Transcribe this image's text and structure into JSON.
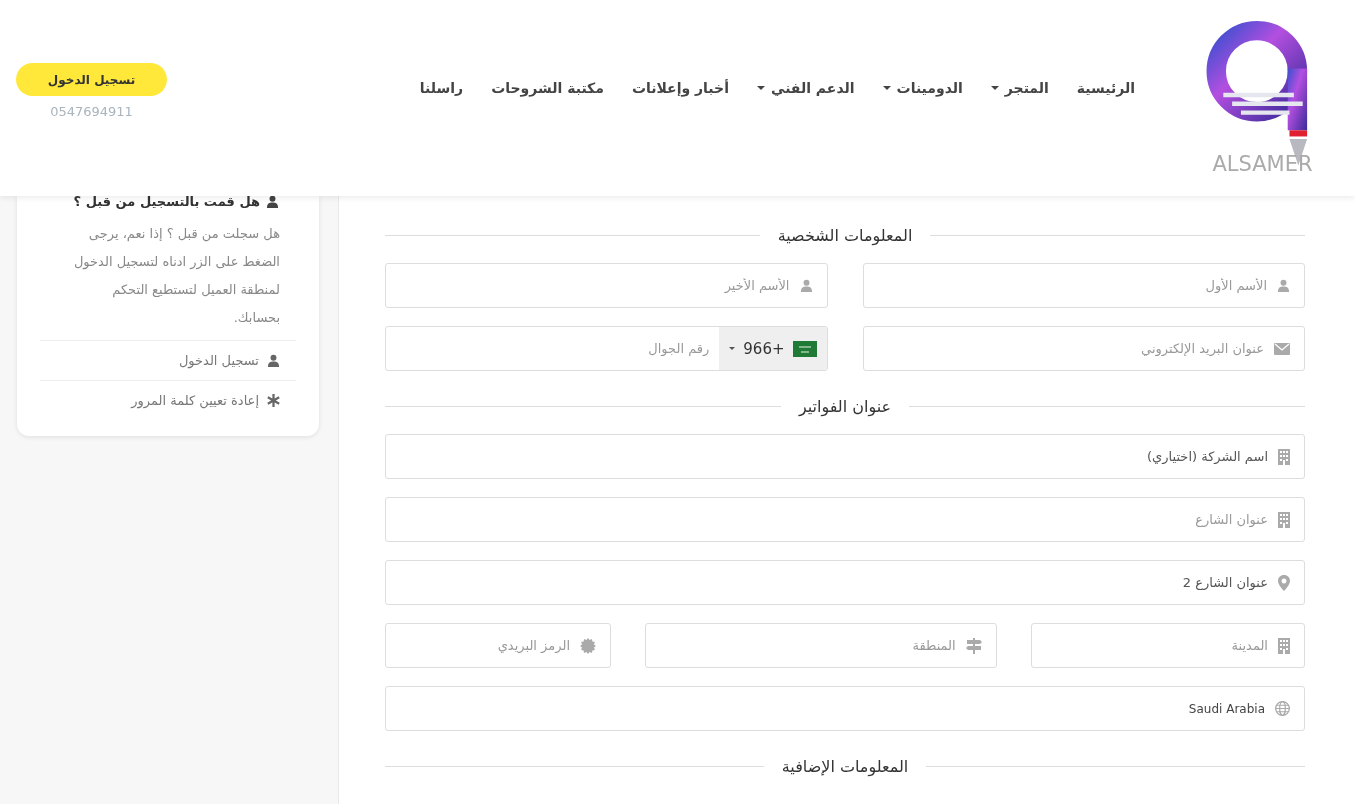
{
  "header": {
    "logo": {
      "text": "ALSAMER"
    },
    "nav": [
      {
        "label": "الرئيسية",
        "dropdown": false
      },
      {
        "label": "المتجر",
        "dropdown": true
      },
      {
        "label": "الدومينات",
        "dropdown": true
      },
      {
        "label": "الدعم الفني",
        "dropdown": true
      },
      {
        "label": "أخبار وإعلانات",
        "dropdown": false
      },
      {
        "label": "مكتبة الشروحات",
        "dropdown": false
      },
      {
        "label": "راسلنا",
        "dropdown": false
      }
    ],
    "login_button": "تسجيل الدخول",
    "phone": "0547694911"
  },
  "sidebar": {
    "title": "هل قمت بالتسجيل من قبل ؟",
    "text": "هل سجلت من قبل ؟ إذا نعم، يرجى الضغط على الزر ادناه لتسجيل الدخول لمنطقة العميل لتستطيع التحكم بحسابك.",
    "links": [
      {
        "label": "تسجيل الدخول"
      },
      {
        "label": "إعادة تعيين كلمة المرور"
      }
    ]
  },
  "form": {
    "sections": [
      {
        "title": "المعلومات الشخصية",
        "rows": [
          [
            {
              "kind": "text",
              "placeholder": "الأسم الأول"
            },
            {
              "kind": "text",
              "placeholder": "الأسم الأخير"
            }
          ],
          [
            {
              "kind": "text",
              "placeholder": "عنوان البريد الإلكتروني"
            },
            {
              "kind": "phone",
              "country_code": "966+",
              "placeholder": "رقم الجوال"
            }
          ]
        ]
      },
      {
        "title": "عنوان الفواتير",
        "rows": [
          [
            {
              "kind": "text",
              "value": "اسم الشركة (اختياري)"
            }
          ],
          [
            {
              "kind": "text",
              "placeholder": "عنوان الشارع"
            }
          ],
          [
            {
              "kind": "text",
              "value": "عنوان الشارع 2"
            }
          ],
          [
            {
              "kind": "text",
              "placeholder": "المدينة"
            },
            {
              "kind": "text",
              "placeholder": "المنطقة"
            },
            {
              "kind": "text",
              "placeholder": "الرمز البريدي"
            }
          ],
          [
            {
              "kind": "select",
              "value": "Saudi Arabia"
            }
          ]
        ]
      },
      {
        "title": "المعلومات الإضافية"
      }
    ]
  }
}
